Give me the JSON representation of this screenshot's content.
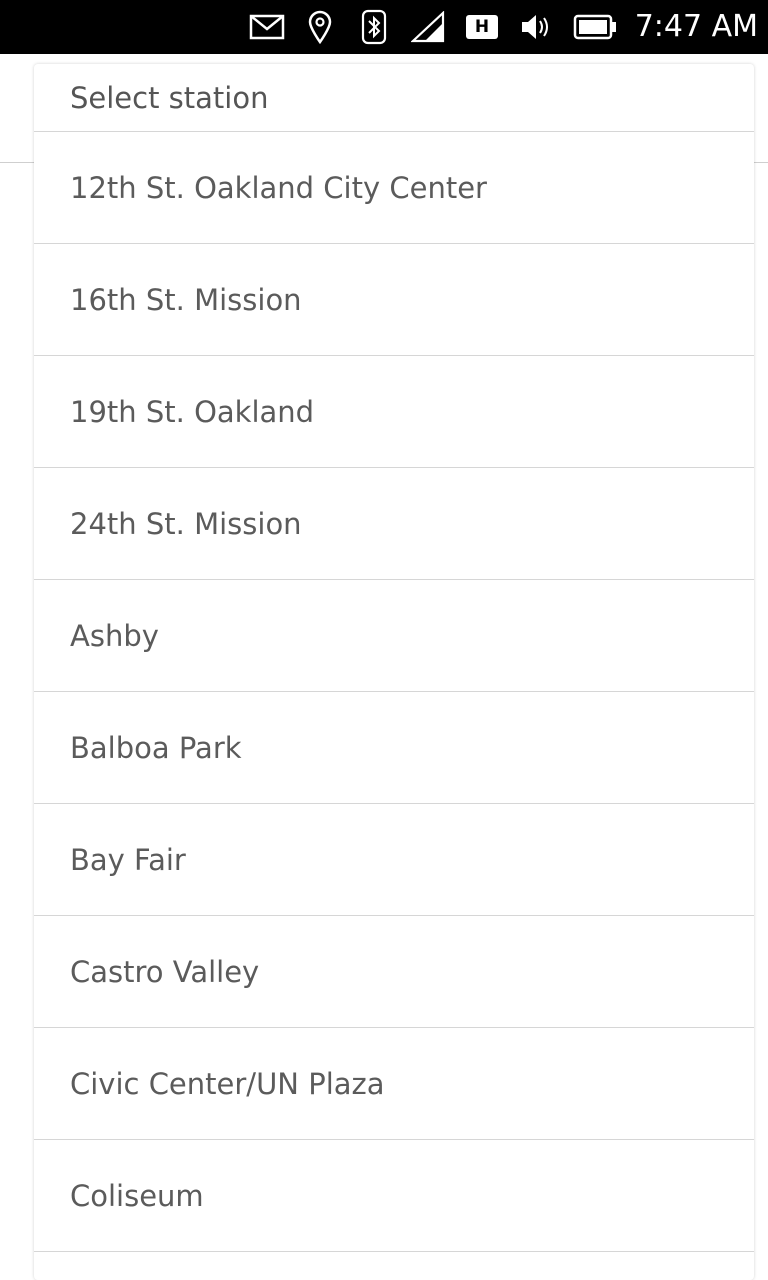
{
  "status_bar": {
    "time": "7:47 AM",
    "icons": [
      "mail-icon",
      "location-pin-icon",
      "bluetooth-icon",
      "signal-icon",
      "network-h-icon",
      "volume-icon",
      "battery-icon"
    ],
    "network_label": "H"
  },
  "dialog": {
    "title": "Select station",
    "stations": [
      "12th St. Oakland City Center",
      "16th St. Mission",
      "19th St. Oakland",
      "24th St. Mission",
      "Ashby",
      "Balboa Park",
      "Bay Fair",
      "Castro Valley",
      "Civic Center/UN Plaza",
      "Coliseum"
    ]
  }
}
